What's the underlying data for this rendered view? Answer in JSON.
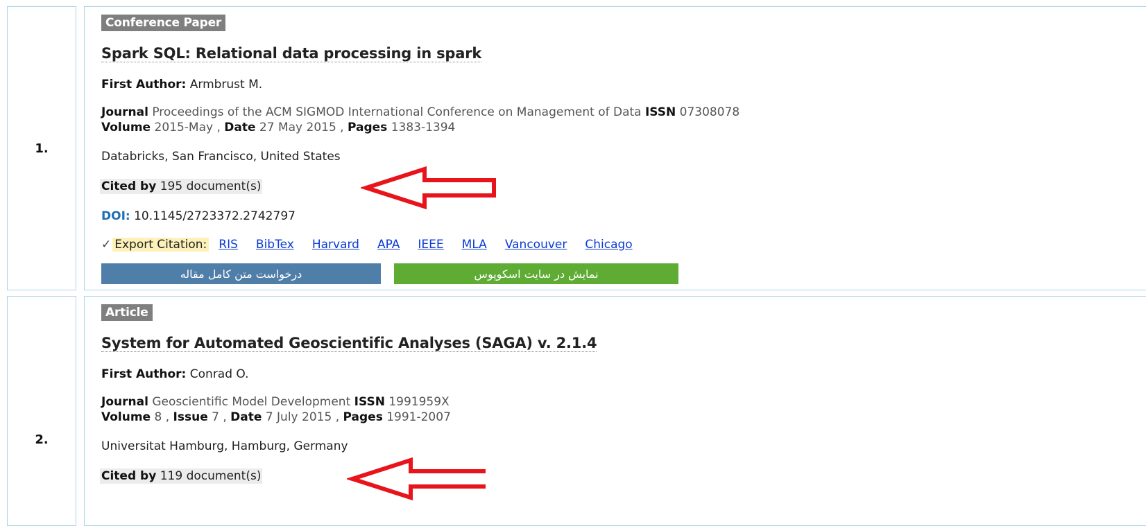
{
  "results": [
    {
      "number": "1.",
      "type": "Conference Paper",
      "title": "Spark SQL: Relational data processing in spark",
      "first_author_label": "First Author:",
      "first_author": "Armbrust M.",
      "journal_label": "Journal",
      "journal": "Proceedings of the ACM SIGMOD International Conference on Management of Data",
      "issn_label": "ISSN",
      "issn": "07308078",
      "volume_label": "Volume",
      "volume": "2015-May ,",
      "date_label": "Date",
      "date": "27 May 2015 ,",
      "pages_label": "Pages",
      "pages": "1383-1394",
      "affiliation": "Databricks, San Francisco, United States",
      "cited_label": "Cited by",
      "cited_count": "195 document(s)",
      "doi_label": "DOI:",
      "doi": "10.1145/2723372.2742797",
      "export_label": "Export Citation:",
      "export_links": [
        "RIS",
        "BibTex",
        "Harvard",
        "APA",
        "IEEE",
        "MLA",
        "Vancouver",
        "Chicago"
      ],
      "request_button": "درخواست متن کامل مقاله",
      "scopus_button": "نمایش در سایت اسکوپوس"
    },
    {
      "number": "2.",
      "type": "Article",
      "title": "System for Automated Geoscientific Analyses (SAGA) v. 2.1.4",
      "first_author_label": "First Author:",
      "first_author": "Conrad O.",
      "journal_label": "Journal",
      "journal": "Geoscientific Model Development",
      "issn_label": "ISSN",
      "issn": "1991959X",
      "volume_label": "Volume",
      "volume": "8 ,",
      "issue_label": "Issue",
      "issue": "7 ,",
      "date_label": "Date",
      "date": "7 July 2015 ,",
      "pages_label": "Pages",
      "pages": "1991-2007",
      "affiliation": "Universitat Hamburg, Hamburg, Germany",
      "cited_label": "Cited by",
      "cited_count": "119 document(s)"
    }
  ],
  "colors": {
    "border": "#a9d3e6",
    "badge": "#7f7f7f",
    "request_button": "#4f7ea8",
    "scopus_button": "#5eac34",
    "arrow": "#e8141c",
    "link": "#0b3bd6",
    "doi": "#1f6fb5"
  },
  "icons": {
    "export_icon": "check-icon",
    "annotation": "red-arrow-annotation"
  }
}
